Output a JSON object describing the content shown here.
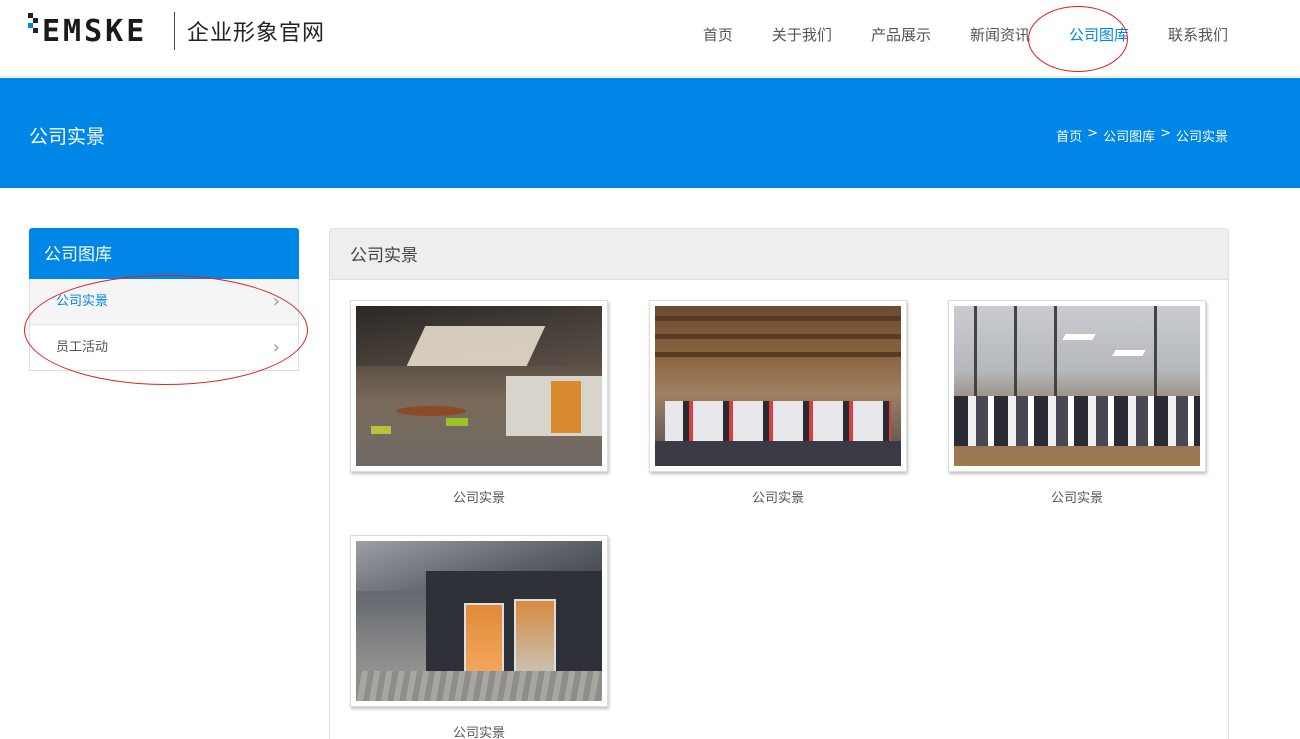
{
  "header": {
    "logo_text": "EMSKE",
    "logo_subtitle": "企业形象官网",
    "nav": [
      {
        "label": "首页",
        "active": false
      },
      {
        "label": "关于我们",
        "active": false
      },
      {
        "label": "产品展示",
        "active": false
      },
      {
        "label": "新闻资讯",
        "active": false
      },
      {
        "label": "公司图库",
        "active": true
      },
      {
        "label": "联系我们",
        "active": false
      }
    ]
  },
  "banner": {
    "title": "公司实景",
    "breadcrumb": [
      "首页",
      ">",
      "公司图库",
      ">",
      "公司实景"
    ]
  },
  "sidebar": {
    "title": "公司图库",
    "items": [
      {
        "label": "公司实景",
        "active": true
      },
      {
        "label": "员工活动",
        "active": false
      }
    ]
  },
  "main": {
    "title": "公司实景",
    "cards": [
      {
        "caption": "公司实景"
      },
      {
        "caption": "公司实景"
      },
      {
        "caption": "公司实景"
      },
      {
        "caption": "公司实景"
      }
    ]
  },
  "colors": {
    "brand_blue": "#0086e6",
    "annotation_red": "#e02020"
  }
}
